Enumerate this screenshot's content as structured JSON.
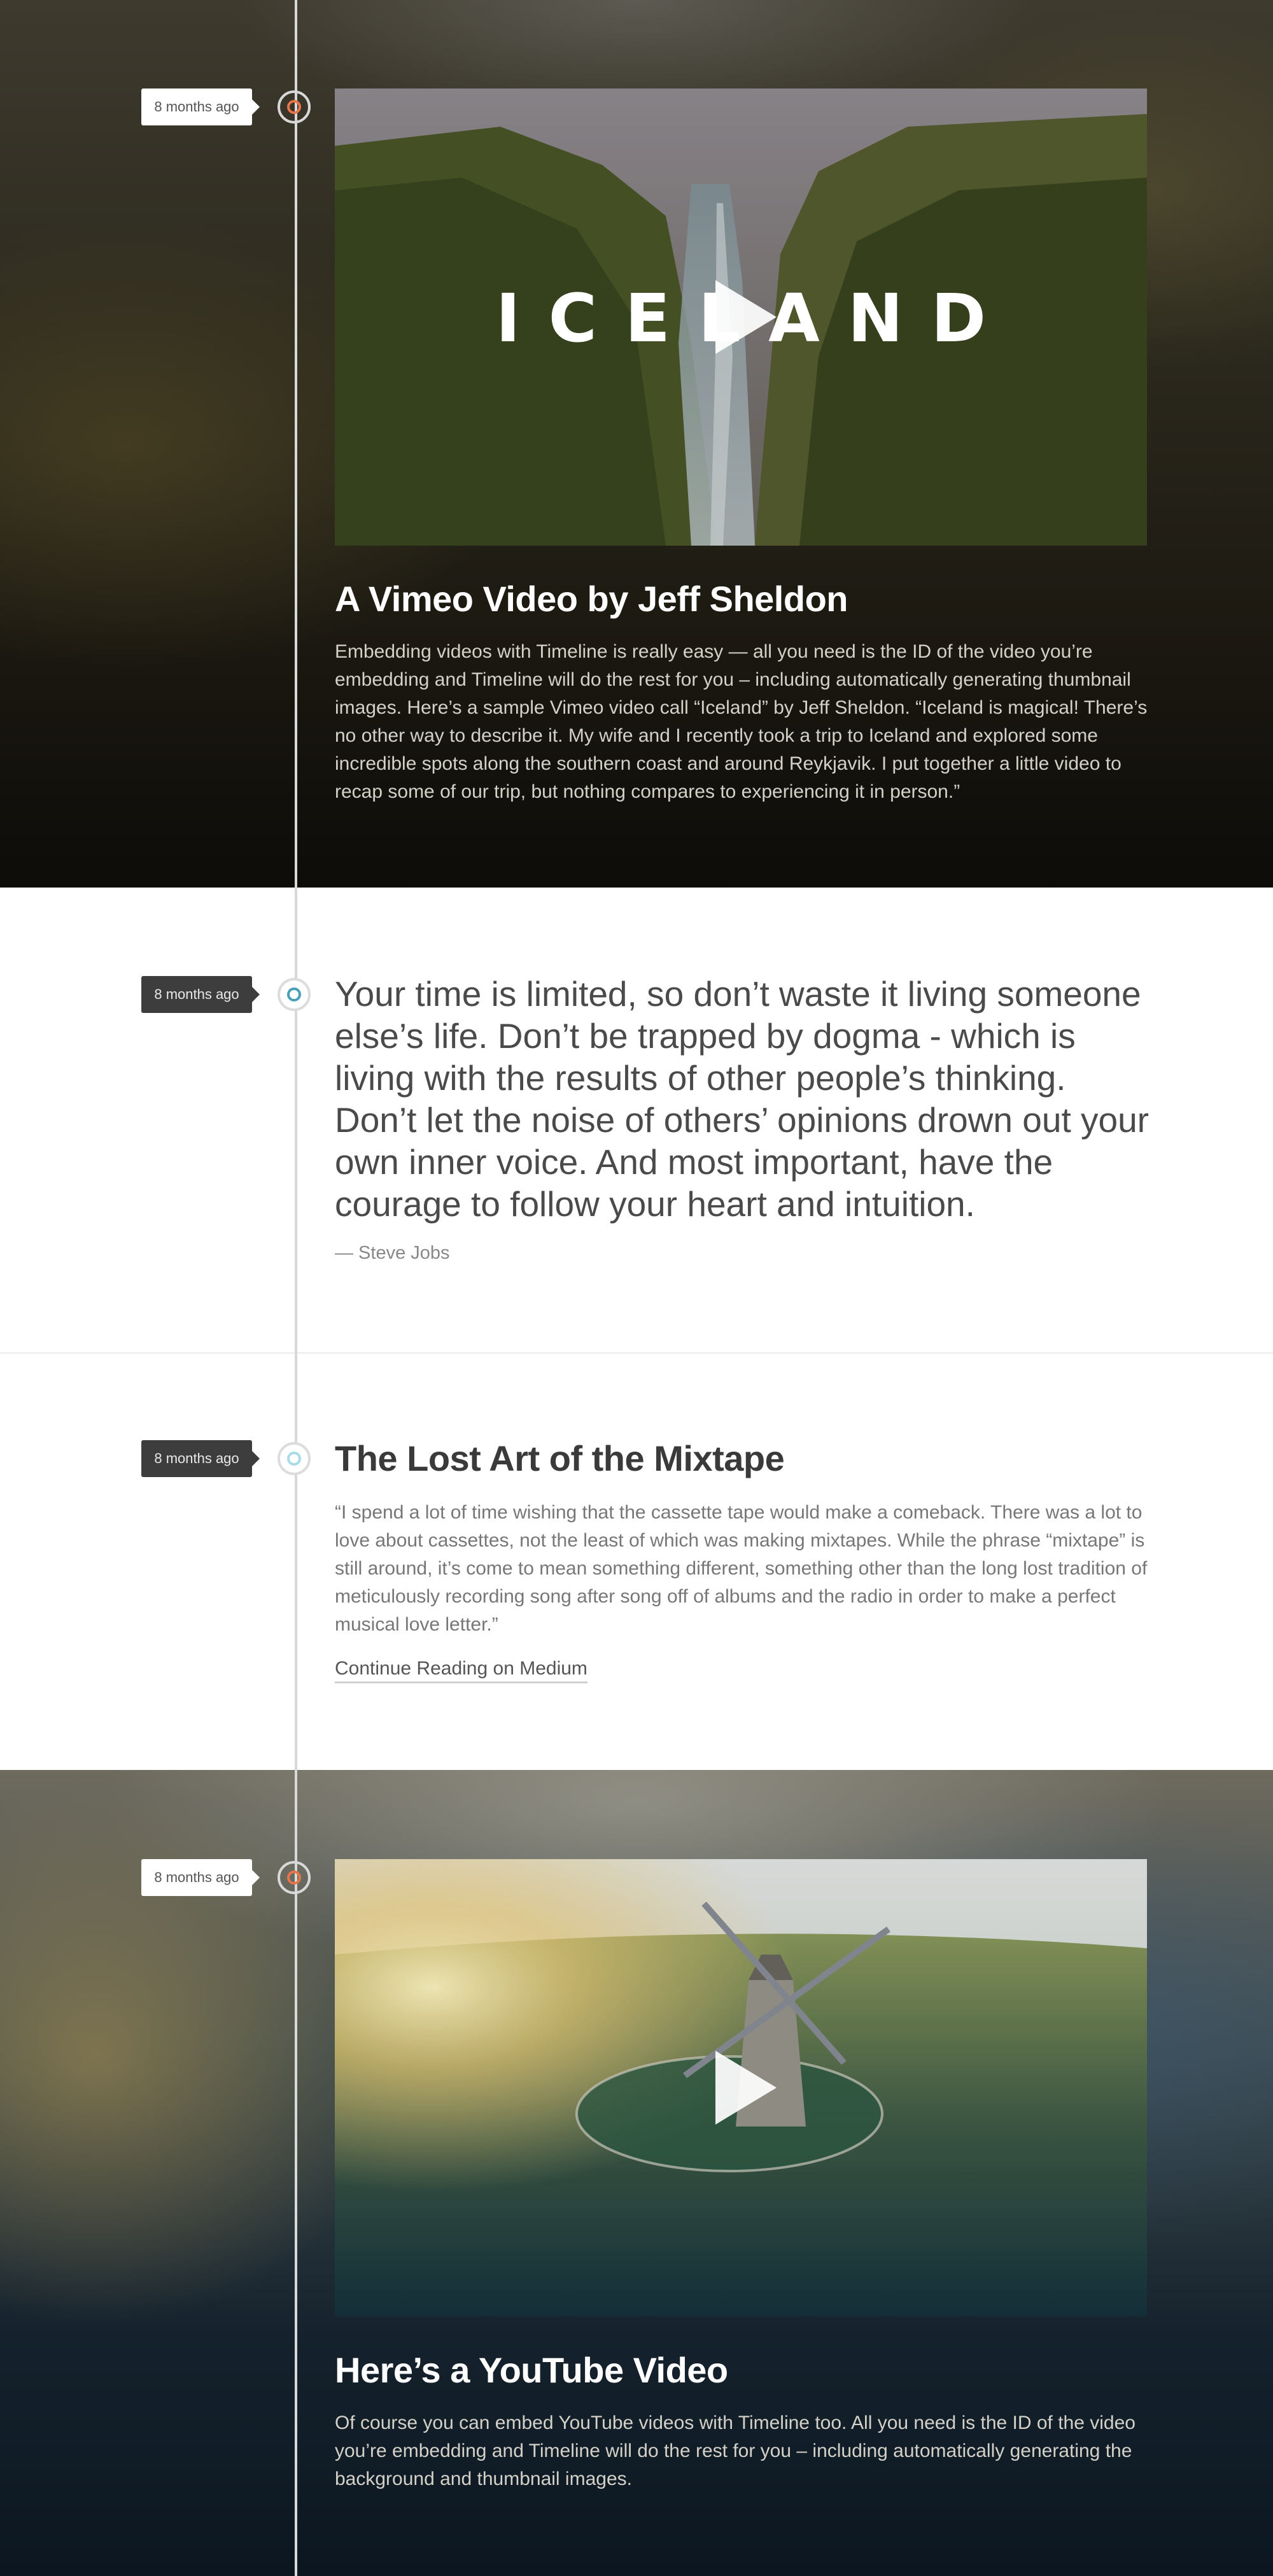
{
  "entries": [
    {
      "time": "8 months ago",
      "media_text": "ICELAND",
      "title": "A Vimeo Video by Jeff Sheldon",
      "body": "Embedding videos with Timeline is really easy — all you need is the ID of the video you’re embedding and Timeline will do the rest for you – including automatically generating thumbnail images. Here’s a sample Vimeo video call “Iceland” by Jeff Sheldon. “Iceland is magical! There’s no other way to describe it. My wife and I recently took a trip to Iceland and explored some incredible spots along the southern coast and around Reykjavik. I put together a little video to recap some of our trip, but nothing compares to experiencing it in person.”"
    },
    {
      "time": "8 months ago",
      "quote": "Your time is limited, so don’t waste it living someone else’s life. Don’t be trapped by dogma - which is living with the results of other people’s thinking. Don’t let the noise of others’ opinions drown out your own inner voice. And most important, have the courage to follow your heart and intuition.",
      "attribution": "— Steve Jobs"
    },
    {
      "time": "8 months ago",
      "title": "The Lost Art of the Mixtape",
      "body": "“I spend a lot of time wishing that the cassette tape would make a comeback. There was a lot to love about cassettes, not the least of which was making mixtapes. While the phrase “mixtape” is still around, it’s come to mean something different, something other than the long lost tradition of meticulously recording song after song off of albums and the radio in order to make a perfect musical love letter.”",
      "link": "Continue Reading on Medium"
    },
    {
      "time": "8 months ago",
      "title": "Here’s a YouTube Video",
      "body": "Of course you can embed YouTube videos with Timeline too. All you need is the ID of the video you’re embedding and Timeline will do the rest for you – including automatically generating the background and thumbnail images."
    }
  ],
  "colors": {
    "accent_video": "#e8744a",
    "accent_quote": "#4a9fb8",
    "accent_article": "#a8dbe8",
    "timeline": "#d8d8d8"
  },
  "icons": [
    "play-icon",
    "timeline-node-icon"
  ]
}
